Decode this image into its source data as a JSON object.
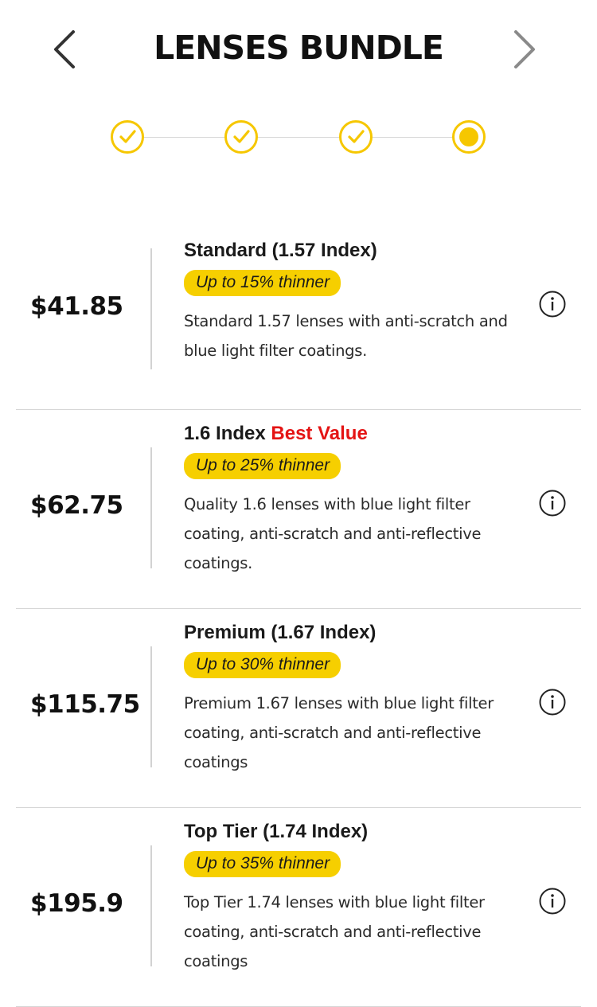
{
  "header": {
    "title": "LENSES BUNDLE"
  },
  "stepper": {
    "steps": [
      {
        "state": "completed"
      },
      {
        "state": "completed"
      },
      {
        "state": "completed"
      },
      {
        "state": "current"
      }
    ],
    "accent_color": "#f6c700"
  },
  "options": [
    {
      "price": "$41.85",
      "title": "Standard (1.57 Index)",
      "badge": "",
      "thinness": "Up to 15% thinner",
      "description": "Standard 1.57 lenses with anti-scratch and blue light filter coatings."
    },
    {
      "price": "$62.75",
      "title": "1.6 Index",
      "badge": "Best Value",
      "thinness": "Up to 25% thinner",
      "description": "Quality 1.6 lenses with blue light filter coating, anti-scratch and anti-reflective coatings."
    },
    {
      "price": "$115.75",
      "title": "Premium (1.67 Index)",
      "badge": "",
      "thinness": "Up to 30% thinner",
      "description": "Premium 1.67 lenses with blue light filter coating, anti-scratch and anti-reflective coatings"
    },
    {
      "price": "$195.9",
      "title": "Top Tier (1.74 Index)",
      "badge": "",
      "thinness": "Up to 35% thinner",
      "description": "Top Tier 1.74 lenses with blue light filter coating, anti-scratch and anti-reflective coatings"
    }
  ],
  "icons": {
    "prev": "chevron-left-icon",
    "next": "chevron-right-icon",
    "info": "info-circle-icon",
    "check": "check-icon"
  },
  "colors": {
    "pill_background": "#f6cf00",
    "badge_text": "#e41414",
    "divider": "#d6d6d6"
  }
}
